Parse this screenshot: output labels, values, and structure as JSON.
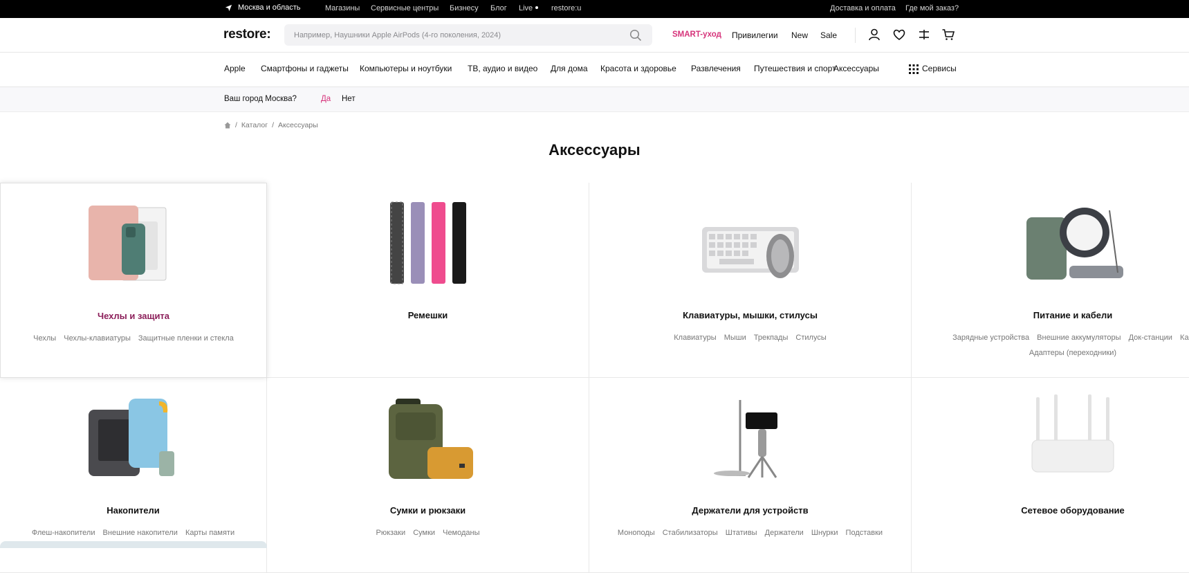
{
  "topbar": {
    "location": "Москва и область",
    "links": [
      "Магазины",
      "Сервисные центры",
      "Бизнесу",
      "Блог",
      "Live",
      "restore:u"
    ],
    "right_links": [
      "Доставка и оплата",
      "Где мой заказ?"
    ]
  },
  "header": {
    "logo": "restore:",
    "search_placeholder": "Например, Наушники Apple AirPods (4-го поколения, 2024)",
    "links": [
      "SMART-уход",
      "Привилегии",
      "New",
      "Sale"
    ],
    "accent_color": "#d6337a"
  },
  "catnav": {
    "items": [
      "Apple",
      "Смартфоны и гаджеты",
      "Компьютеры и ноутбуки",
      "ТВ, аудио и видео",
      "Для дома",
      "Красота и здоровье",
      "Развлечения",
      "Путешествия и спорт",
      "Аксессуары"
    ],
    "services": "Сервисы"
  },
  "city": {
    "question": "Ваш город Москва?",
    "yes": "Да",
    "no": "Нет"
  },
  "breadcrumbs": [
    "Каталог",
    "Аксессуары"
  ],
  "page_title": "Аксессуары",
  "cards": [
    {
      "name": "Чехлы и защита",
      "subs": [
        "Чехлы",
        "Чехлы-клавиатуры",
        "Защитные пленки и стекла"
      ],
      "icon": "cases-image"
    },
    {
      "name": "Ремешки",
      "subs": [],
      "icon": "straps-image"
    },
    {
      "name": "Клавиатуры, мышки, стилусы",
      "subs": [
        "Клавиатуры",
        "Мыши",
        "Трекпады",
        "Стилусы"
      ],
      "icon": "keyboard-image"
    },
    {
      "name": "Питание и кабели",
      "subs": [
        "Зарядные устройства",
        "Внешние аккумуляторы",
        "Док-станции",
        "Каб",
        "Адаптеры (переходники)"
      ],
      "icon": "charger-image"
    },
    {
      "name": "Накопители",
      "subs": [
        "Флеш-накопители",
        "Внешние накопители",
        "Карты памяти"
      ],
      "icon": "drives-image"
    },
    {
      "name": "Сумки и рюкзаки",
      "subs": [
        "Рюкзаки",
        "Сумки",
        "Чемоданы"
      ],
      "icon": "backpack-image"
    },
    {
      "name": "Держатели для устройств",
      "subs": [
        "Моноподы",
        "Стабилизаторы",
        "Штативы",
        "Держатели",
        "Шнурки",
        "Подставки"
      ],
      "icon": "holder-image"
    },
    {
      "name": "Сетевое оборудование",
      "subs": [],
      "icon": "router-image"
    }
  ]
}
